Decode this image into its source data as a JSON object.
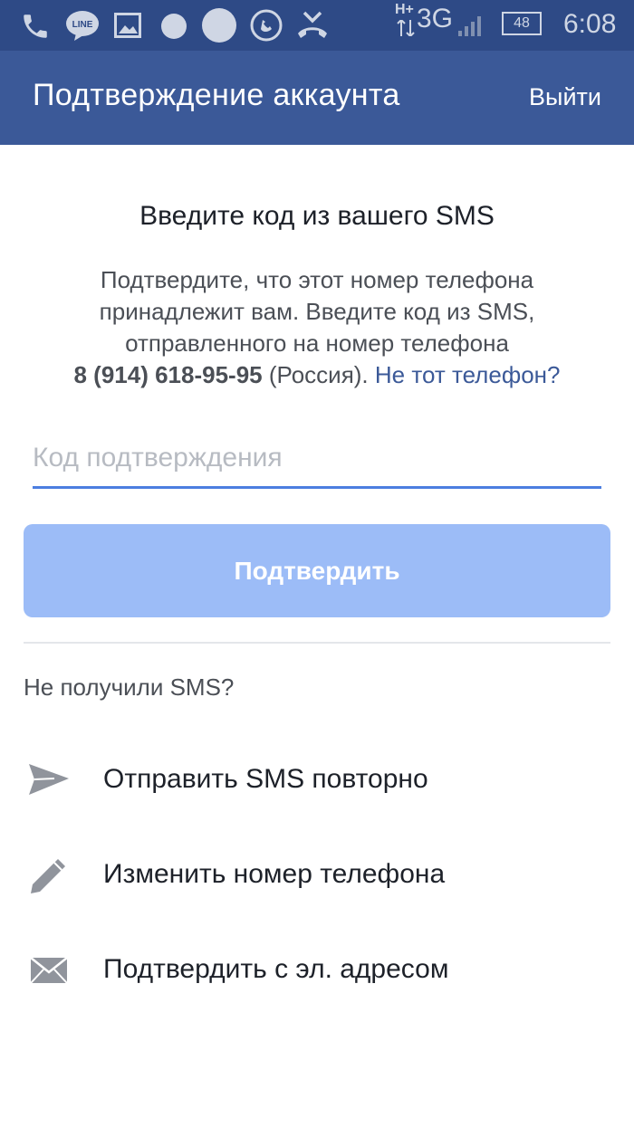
{
  "statusbar": {
    "network": "3G",
    "network_prefix": "H+",
    "battery": "48",
    "time": "6:08",
    "line_badge": "LINE"
  },
  "appbar": {
    "title": "Подтверждение аккаунта",
    "action": "Выйти"
  },
  "main": {
    "heading": "Введите код из вашего SMS",
    "description_lines": [
      "Подтвердите, что этот номер телефона",
      "принадлежит вам. Введите код из SMS,",
      "отправленного на номер телефона"
    ],
    "phone": "8 (914) 618-95-95",
    "country": " (Россия). ",
    "wrong_phone_link": "Не тот телефон?",
    "code_placeholder": "Код подтверждения",
    "code_value": "",
    "confirm_label": "Подтвердить",
    "not_received": "Не получили SMS?"
  },
  "options": [
    {
      "icon": "send-icon",
      "label": "Отправить SMS повторно"
    },
    {
      "icon": "pencil-icon",
      "label": "Изменить номер телефона"
    },
    {
      "icon": "envelope-icon",
      "label": "Подтвердить с эл. адресом"
    }
  ],
  "colors": {
    "appbar": "#3b5998",
    "statusbar": "#2e4a86",
    "button_disabled": "#9cbcf7",
    "input_focus": "#4c7ee0",
    "link": "#3b5998"
  }
}
